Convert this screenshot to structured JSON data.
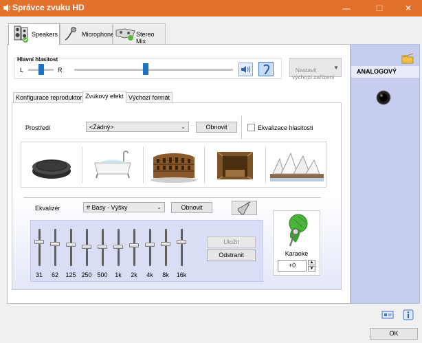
{
  "window": {
    "title": "Správce zvuku HD",
    "minimize": "—",
    "maximize": "☐",
    "close": "✕"
  },
  "tabs": [
    {
      "label": "Speakers",
      "icon": "speakers-icon",
      "active": true
    },
    {
      "label": "Microphone",
      "icon": "microphone-icon",
      "active": false
    },
    {
      "label": "Stereo Mix",
      "icon": "stereo-mix-icon",
      "active": false
    }
  ],
  "volume": {
    "title": "Hlavní hlasitost",
    "left_label": "L",
    "right_label": "R",
    "balance_fraction": 0.5,
    "level_fraction": 0.45
  },
  "default_device_button": "Nastavit\nvýchozí zařízení",
  "subtabs": [
    {
      "label": "Konfigurace reproduktorů",
      "active": false
    },
    {
      "label": "Zvukový efekt",
      "active": true
    },
    {
      "label": "Výchozí formát",
      "active": false
    }
  ],
  "environment": {
    "label": "Prostředí",
    "selected": "<Žádný>",
    "reset_label": "Obnovit",
    "loudness_label": "Ekvalizace hlasitosti",
    "loudness_checked": false,
    "presets": [
      "stone-disc",
      "bathtub",
      "colosseum",
      "wooden-room",
      "opera-house"
    ]
  },
  "equalizer": {
    "label": "Ekvalizér",
    "selected": "# Basy - Výšky",
    "reset_label": "Obnovit",
    "save_label": "Uložit",
    "delete_label": "Odstranit",
    "bands": [
      {
        "freq": "31",
        "level": 0.35
      },
      {
        "freq": "62",
        "level": 0.4
      },
      {
        "freq": "125",
        "level": 0.42
      },
      {
        "freq": "250",
        "level": 0.48
      },
      {
        "freq": "500",
        "level": 0.48
      },
      {
        "freq": "1k",
        "level": 0.48
      },
      {
        "freq": "2k",
        "level": 0.44
      },
      {
        "freq": "4k",
        "level": 0.42
      },
      {
        "freq": "8k",
        "level": 0.4
      },
      {
        "freq": "16k",
        "level": 0.35
      }
    ]
  },
  "karaoke": {
    "label": "Karaoke",
    "value": "+0"
  },
  "right_panel": {
    "title": "ANALOGOVÝ"
  },
  "ok_label": "OK",
  "colors": {
    "titlebar": "#e2712b",
    "accent": "#1c73c5",
    "right_panel": "#c7cdee"
  }
}
